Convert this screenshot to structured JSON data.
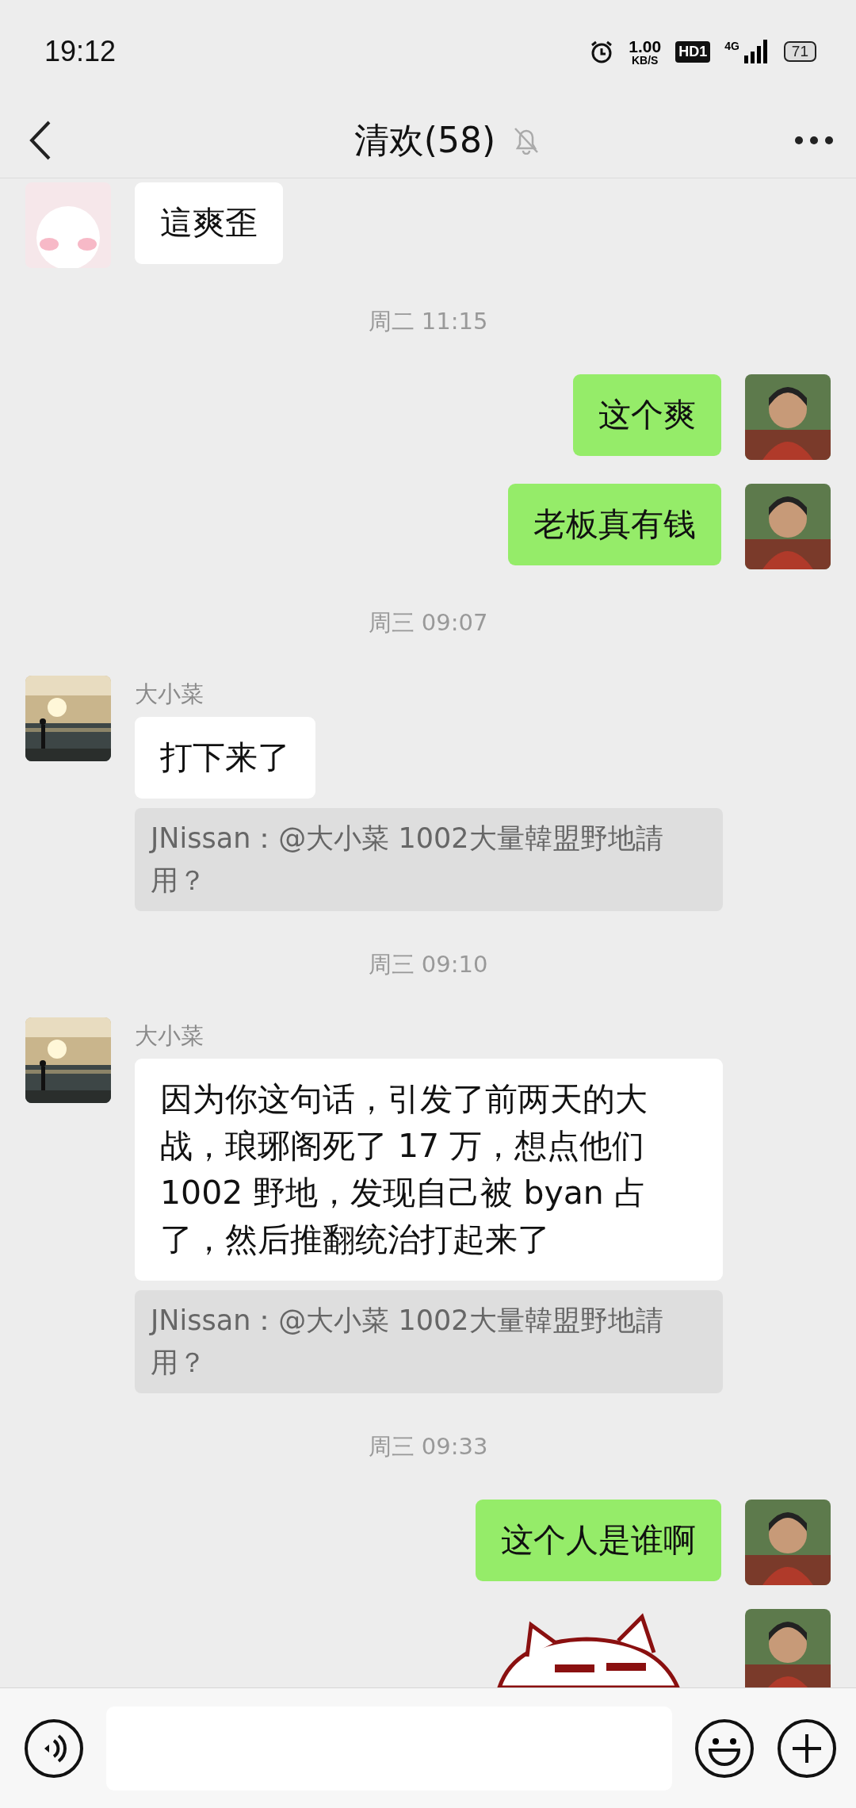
{
  "status_bar": {
    "time": "19:12",
    "speed_value": "1.00",
    "speed_unit": "KB/S",
    "hd_badge": "HD1",
    "network": "4G",
    "battery": "71"
  },
  "header": {
    "title": "清欢(58)",
    "muted": true
  },
  "messages": [
    {
      "kind": "text",
      "outgoing": false,
      "avatar": {
        "kind": "cartoon"
      },
      "text": "這爽歪"
    },
    {
      "kind": "time",
      "text": "周二 11:15"
    },
    {
      "kind": "text",
      "outgoing": true,
      "avatar": {
        "kind": "figure"
      },
      "text": "这个爽"
    },
    {
      "kind": "text",
      "outgoing": true,
      "avatar": {
        "kind": "figure"
      },
      "text": "老板真有钱"
    },
    {
      "kind": "time",
      "text": "周三 09:07"
    },
    {
      "kind": "text",
      "outgoing": false,
      "sender": "大小菜",
      "text": "打下来了"
    },
    {
      "kind": "quote",
      "text": "JNissan：@大小菜 1002大量韓盟野地請用？"
    },
    {
      "kind": "time",
      "text": "周三 09:10"
    },
    {
      "kind": "text",
      "outgoing": false,
      "sender": "大小菜",
      "text": "因为你这句话，引发了前两天的大战，琅琊阁死了 17 万，想点他们 1002 野地，发现自己被 byan 占了，然后推翻统治打起来了"
    },
    {
      "kind": "quote",
      "text": "JNissan：@大小菜 1002大量韓盟野地請用？"
    },
    {
      "kind": "time",
      "text": "周三 09:33"
    },
    {
      "kind": "text",
      "outgoing": true,
      "avatar": {
        "kind": "figure"
      },
      "text": "这个人是谁啊"
    },
    {
      "kind": "sticker",
      "outgoing": true,
      "avatar": {
        "kind": "figure"
      }
    }
  ]
}
